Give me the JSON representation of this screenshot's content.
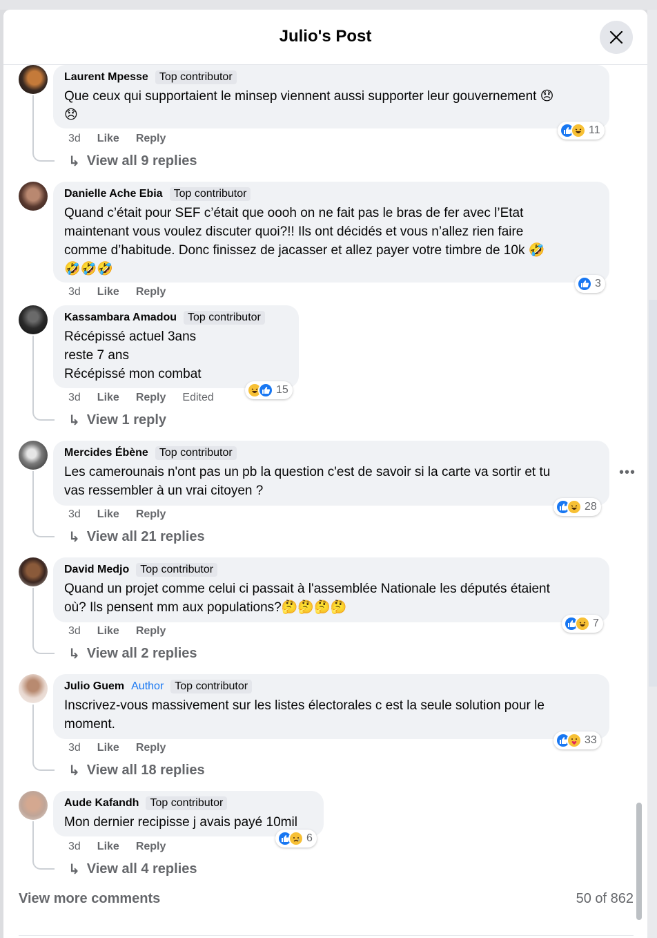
{
  "header": {
    "title": "Julio's Post"
  },
  "comments": [
    {
      "name": "Laurent Mpesse",
      "badges": [
        "Top contributor"
      ],
      "text": [
        "Que ceux qui supportaient le minsep viennent aussi supporter leur gouvernement 😞",
        "😞"
      ],
      "time": "3d",
      "like": "Like",
      "reply": "Reply",
      "reactions": [
        "like",
        "haha"
      ],
      "reaction_count": "11",
      "view_replies": "View all 9 replies"
    },
    {
      "name": "Danielle Ache Ebia",
      "badges": [
        "Top contributor"
      ],
      "text": [
        "Quand c’était pour SEF c’était que oooh on ne fait pas le bras de fer avec l’Etat",
        "maintenant vous voulez discuter quoi?!! Ils ont décidés et vous n’allez rien faire",
        "comme d’habitude. Donc finissez de jacasser et allez payer votre timbre de 10k 🤣",
        "🤣🤣🤣"
      ],
      "time": "3d",
      "like": "Like",
      "reply": "Reply",
      "reactions": [
        "like"
      ],
      "reaction_count": "3"
    },
    {
      "name": "Kassambara Amadou",
      "badges": [
        "Top contributor"
      ],
      "text": [
        "Récépissé actuel 3ans",
        "reste 7 ans",
        "Récépissé mon combat"
      ],
      "time": "3d",
      "like": "Like",
      "reply": "Reply",
      "edited": "Edited",
      "reactions": [
        "haha",
        "like"
      ],
      "reaction_count": "15",
      "view_replies": "View 1 reply"
    },
    {
      "name": "Mercides Ébène",
      "badges": [
        "Top contributor"
      ],
      "text": [
        "Les camerounais n'ont pas un pb la question c'est de savoir si la carte va sortir et tu",
        "vas ressembler à un vrai citoyen ?"
      ],
      "time": "3d",
      "like": "Like",
      "reply": "Reply",
      "reactions": [
        "like",
        "haha"
      ],
      "reaction_count": "28",
      "view_replies": "View all 21 replies",
      "more": "•••"
    },
    {
      "name": "David Medjo",
      "badges": [
        "Top contributor"
      ],
      "text": [
        "Quand un projet comme celui ci passait à l'assemblée Nationale les députés étaient",
        "où? Ils pensent mm aux populations?🤔🤔🤔🤔"
      ],
      "time": "3d",
      "like": "Like",
      "reply": "Reply",
      "reactions": [
        "like",
        "haha"
      ],
      "reaction_count": "7",
      "view_replies": "View all 2 replies"
    },
    {
      "name": "Julio Guem",
      "author": "Author",
      "badges": [
        "Top contributor"
      ],
      "text": [
        "Inscrivez-vous massivement sur les listes électorales c est la seule solution pour le",
        "moment."
      ],
      "time": "3d",
      "like": "Like",
      "reply": "Reply",
      "reactions": [
        "like",
        "care"
      ],
      "reaction_count": "33",
      "view_replies": "View all 18 replies"
    },
    {
      "name": "Aude Kafandh",
      "badges": [
        "Top contributor"
      ],
      "text": [
        "Mon dernier recipisse j avais payé 10mil"
      ],
      "time": "3d",
      "like": "Like",
      "reply": "Reply",
      "reactions": [
        "like",
        "sad"
      ],
      "reaction_count": "6",
      "view_replies": "View all 4 replies"
    }
  ],
  "footer": {
    "view_more": "View more comments",
    "count": "50 of 862"
  },
  "colors": {
    "accent": "#1877f2",
    "bubble": "#f0f2f5",
    "muted": "#65676b"
  }
}
